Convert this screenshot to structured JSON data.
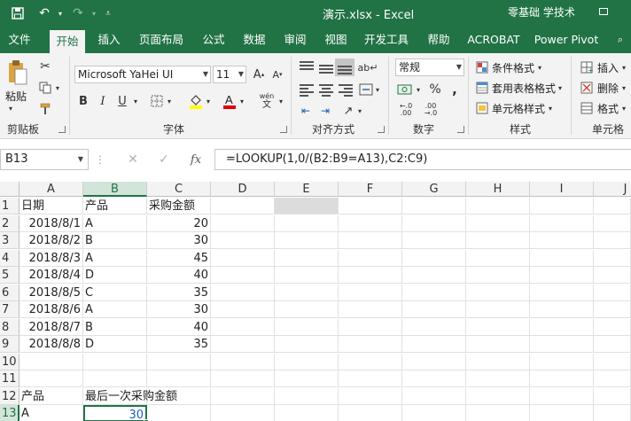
{
  "window": {
    "title": "演示.xlsx  -  Excel",
    "user": "零基础 学技术"
  },
  "tabs": [
    "文件",
    "开始",
    "插入",
    "页面布局",
    "公式",
    "数据",
    "审阅",
    "视图",
    "开发工具",
    "帮助",
    "ACROBAT",
    "Power Pivot"
  ],
  "ribbon": {
    "paste": "粘贴",
    "font_name": "Microsoft YaHei UI",
    "font_size": "11",
    "number_format": "常规",
    "cond_format": "条件格式",
    "table_format": "套用表格格式",
    "cell_style": "单元格样式",
    "insert": "插入",
    "delete": "删除",
    "format": "格式",
    "groups": {
      "clipboard": "剪贴板",
      "font": "字体",
      "alignment": "对齐方式",
      "number": "数字",
      "styles": "样式",
      "cells": "单元格"
    }
  },
  "formula_bar": {
    "name_box": "B13",
    "formula": "=LOOKUP(1,0/(B2:B9=A13),C2:C9)",
    "fx": "fx"
  },
  "sheet": {
    "columns": [
      "A",
      "B",
      "C",
      "D",
      "E",
      "F",
      "G",
      "H",
      "I",
      "J"
    ],
    "rows": [
      "1",
      "2",
      "3",
      "4",
      "5",
      "6",
      "7",
      "8",
      "9",
      "10",
      "11",
      "12",
      "13"
    ],
    "cells": {
      "A1": "日期",
      "B1": "产品",
      "C1": "采购金额",
      "A2": "2018/8/1",
      "B2": "A",
      "C2": "20",
      "A3": "2018/8/2",
      "B3": "B",
      "C3": "30",
      "A4": "2018/8/3",
      "B4": "A",
      "C4": "45",
      "A5": "2018/8/4",
      "B5": "D",
      "C5": "40",
      "A6": "2018/8/5",
      "B6": "C",
      "C6": "35",
      "A7": "2018/8/6",
      "B7": "A",
      "C7": "30",
      "A8": "2018/8/7",
      "B8": "B",
      "C8": "40",
      "A9": "2018/8/8",
      "B9": "D",
      "C9": "35",
      "A12": "产品",
      "B12": "最后一次采购金额",
      "A13": "A",
      "B13": "30"
    }
  },
  "colors": {
    "accent": "#217346",
    "selected_text": "#1a5fb4"
  }
}
